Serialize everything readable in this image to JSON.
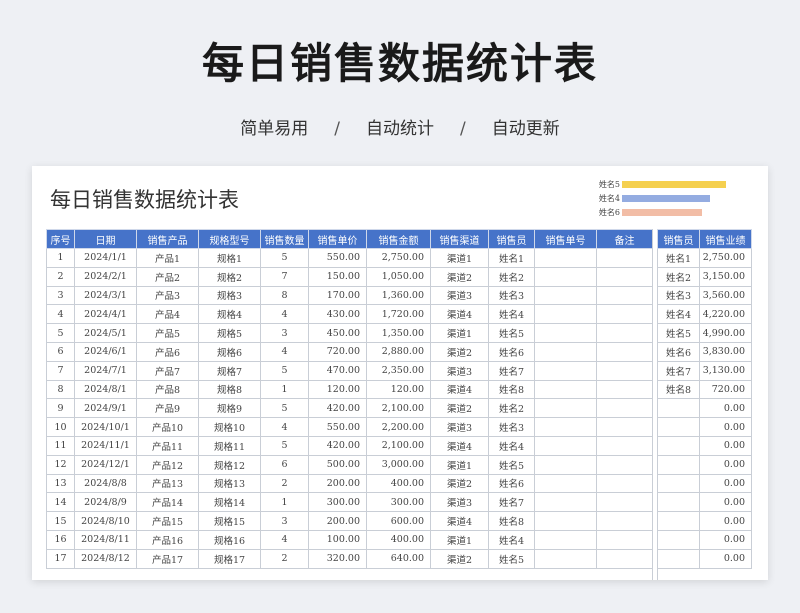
{
  "hero": {
    "title": "每日销售数据统计表",
    "tags": [
      "简单易用",
      "自动统计",
      "自动更新"
    ],
    "separator": "/"
  },
  "sheet": {
    "title": "每日销售数据统计表"
  },
  "mini_chart": {
    "type": "bar",
    "categories": [
      "姓名5",
      "姓名4",
      "姓名6"
    ],
    "values": [
      4990,
      4220,
      3830
    ],
    "colors": [
      "#f5d04f",
      "#94ace1",
      "#f2bda6"
    ],
    "xlim": [
      0,
      5000
    ]
  },
  "table": {
    "headers": [
      "序号",
      "日期",
      "销售产品",
      "规格型号",
      "销售数量",
      "销售单价",
      "销售金额",
      "销售渠道",
      "销售员",
      "销售单号",
      "备注"
    ],
    "rows": [
      [
        "1",
        "2024/1/1",
        "产品1",
        "规格1",
        "5",
        "550.00",
        "2,750.00",
        "渠道1",
        "姓名1",
        "",
        ""
      ],
      [
        "2",
        "2024/2/1",
        "产品2",
        "规格2",
        "7",
        "150.00",
        "1,050.00",
        "渠道2",
        "姓名2",
        "",
        ""
      ],
      [
        "3",
        "2024/3/1",
        "产品3",
        "规格3",
        "8",
        "170.00",
        "1,360.00",
        "渠道3",
        "姓名3",
        "",
        ""
      ],
      [
        "4",
        "2024/4/1",
        "产品4",
        "规格4",
        "4",
        "430.00",
        "1,720.00",
        "渠道4",
        "姓名4",
        "",
        ""
      ],
      [
        "5",
        "2024/5/1",
        "产品5",
        "规格5",
        "3",
        "450.00",
        "1,350.00",
        "渠道1",
        "姓名5",
        "",
        ""
      ],
      [
        "6",
        "2024/6/1",
        "产品6",
        "规格6",
        "4",
        "720.00",
        "2,880.00",
        "渠道2",
        "姓名6",
        "",
        ""
      ],
      [
        "7",
        "2024/7/1",
        "产品7",
        "规格7",
        "5",
        "470.00",
        "2,350.00",
        "渠道3",
        "姓名7",
        "",
        ""
      ],
      [
        "8",
        "2024/8/1",
        "产品8",
        "规格8",
        "1",
        "120.00",
        "120.00",
        "渠道4",
        "姓名8",
        "",
        ""
      ],
      [
        "9",
        "2024/9/1",
        "产品9",
        "规格9",
        "5",
        "420.00",
        "2,100.00",
        "渠道2",
        "姓名2",
        "",
        ""
      ],
      [
        "10",
        "2024/10/1",
        "产品10",
        "规格10",
        "4",
        "550.00",
        "2,200.00",
        "渠道3",
        "姓名3",
        "",
        ""
      ],
      [
        "11",
        "2024/11/1",
        "产品11",
        "规格11",
        "5",
        "420.00",
        "2,100.00",
        "渠道4",
        "姓名4",
        "",
        ""
      ],
      [
        "12",
        "2024/12/1",
        "产品12",
        "规格12",
        "6",
        "500.00",
        "3,000.00",
        "渠道1",
        "姓名5",
        "",
        ""
      ],
      [
        "13",
        "2024/8/8",
        "产品13",
        "规格13",
        "2",
        "200.00",
        "400.00",
        "渠道2",
        "姓名6",
        "",
        ""
      ],
      [
        "14",
        "2024/8/9",
        "产品14",
        "规格14",
        "1",
        "300.00",
        "300.00",
        "渠道3",
        "姓名7",
        "",
        ""
      ],
      [
        "15",
        "2024/8/10",
        "产品15",
        "规格15",
        "3",
        "200.00",
        "600.00",
        "渠道4",
        "姓名8",
        "",
        ""
      ],
      [
        "16",
        "2024/8/11",
        "产品16",
        "规格16",
        "4",
        "100.00",
        "400.00",
        "渠道1",
        "姓名4",
        "",
        ""
      ],
      [
        "17",
        "2024/8/12",
        "产品17",
        "规格17",
        "2",
        "320.00",
        "640.00",
        "渠道2",
        "姓名5",
        "",
        ""
      ]
    ]
  },
  "summary": {
    "headers": [
      "销售员",
      "销售业绩"
    ],
    "rows": [
      [
        "姓名1",
        "2,750.00"
      ],
      [
        "姓名2",
        "3,150.00"
      ],
      [
        "姓名3",
        "3,560.00"
      ],
      [
        "姓名4",
        "4,220.00"
      ],
      [
        "姓名5",
        "4,990.00"
      ],
      [
        "姓名6",
        "3,830.00"
      ],
      [
        "姓名7",
        "3,130.00"
      ],
      [
        "姓名8",
        "720.00"
      ],
      [
        "",
        "0.00"
      ],
      [
        "",
        "0.00"
      ],
      [
        "",
        "0.00"
      ],
      [
        "",
        "0.00"
      ],
      [
        "",
        "0.00"
      ],
      [
        "",
        "0.00"
      ],
      [
        "",
        "0.00"
      ],
      [
        "",
        "0.00"
      ],
      [
        "",
        "0.00"
      ]
    ]
  }
}
